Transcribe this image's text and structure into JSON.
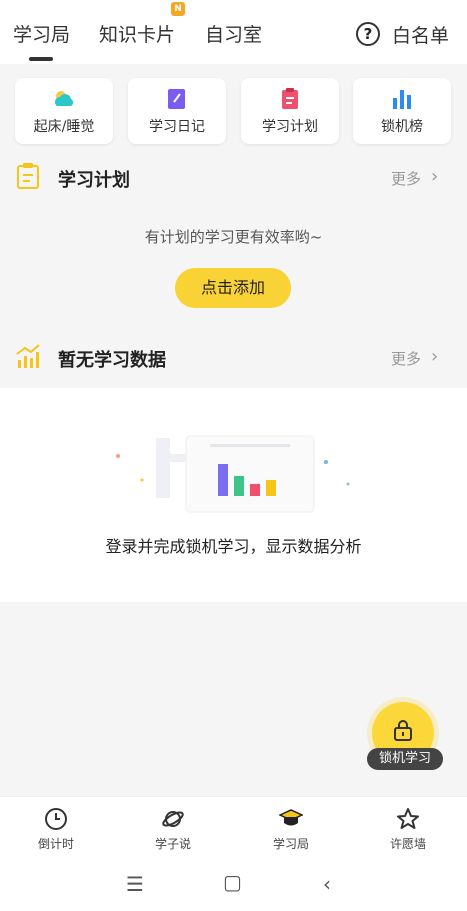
{
  "top_tabs": [
    {
      "label": "学习局"
    },
    {
      "label": "知识卡片"
    },
    {
      "label": "自习室"
    }
  ],
  "new_badge": "N",
  "help_symbol": "?",
  "whitelist_label": "白名单",
  "tiles": [
    {
      "label": "起床/睡觉",
      "icon": "weather-cloud-icon"
    },
    {
      "label": "学习日记",
      "icon": "notebook-icon"
    },
    {
      "label": "学习计划",
      "icon": "clipboard-icon"
    },
    {
      "label": "锁机榜",
      "icon": "bar-chart-icon"
    }
  ],
  "plan_section": {
    "title": "学习计划",
    "more": "更多",
    "empty_text": "有计划的学习更有效率哟~",
    "add_button": "点击添加"
  },
  "data_section": {
    "title": "暂无学习数据",
    "more": "更多",
    "empty_text": "登录并完成锁机学习，显示数据分析"
  },
  "fab": {
    "label": "锁机学习"
  },
  "bottom_nav": [
    {
      "label": "倒计时"
    },
    {
      "label": "学子说"
    },
    {
      "label": "学习局"
    },
    {
      "label": "许愿墙"
    }
  ],
  "colors": {
    "accent": "#f9d236",
    "tile_blue": "#2a8cf0",
    "tile_purple": "#7b5cf0",
    "tile_red": "#f0506e",
    "tile_teal": "#2cc7c7"
  }
}
